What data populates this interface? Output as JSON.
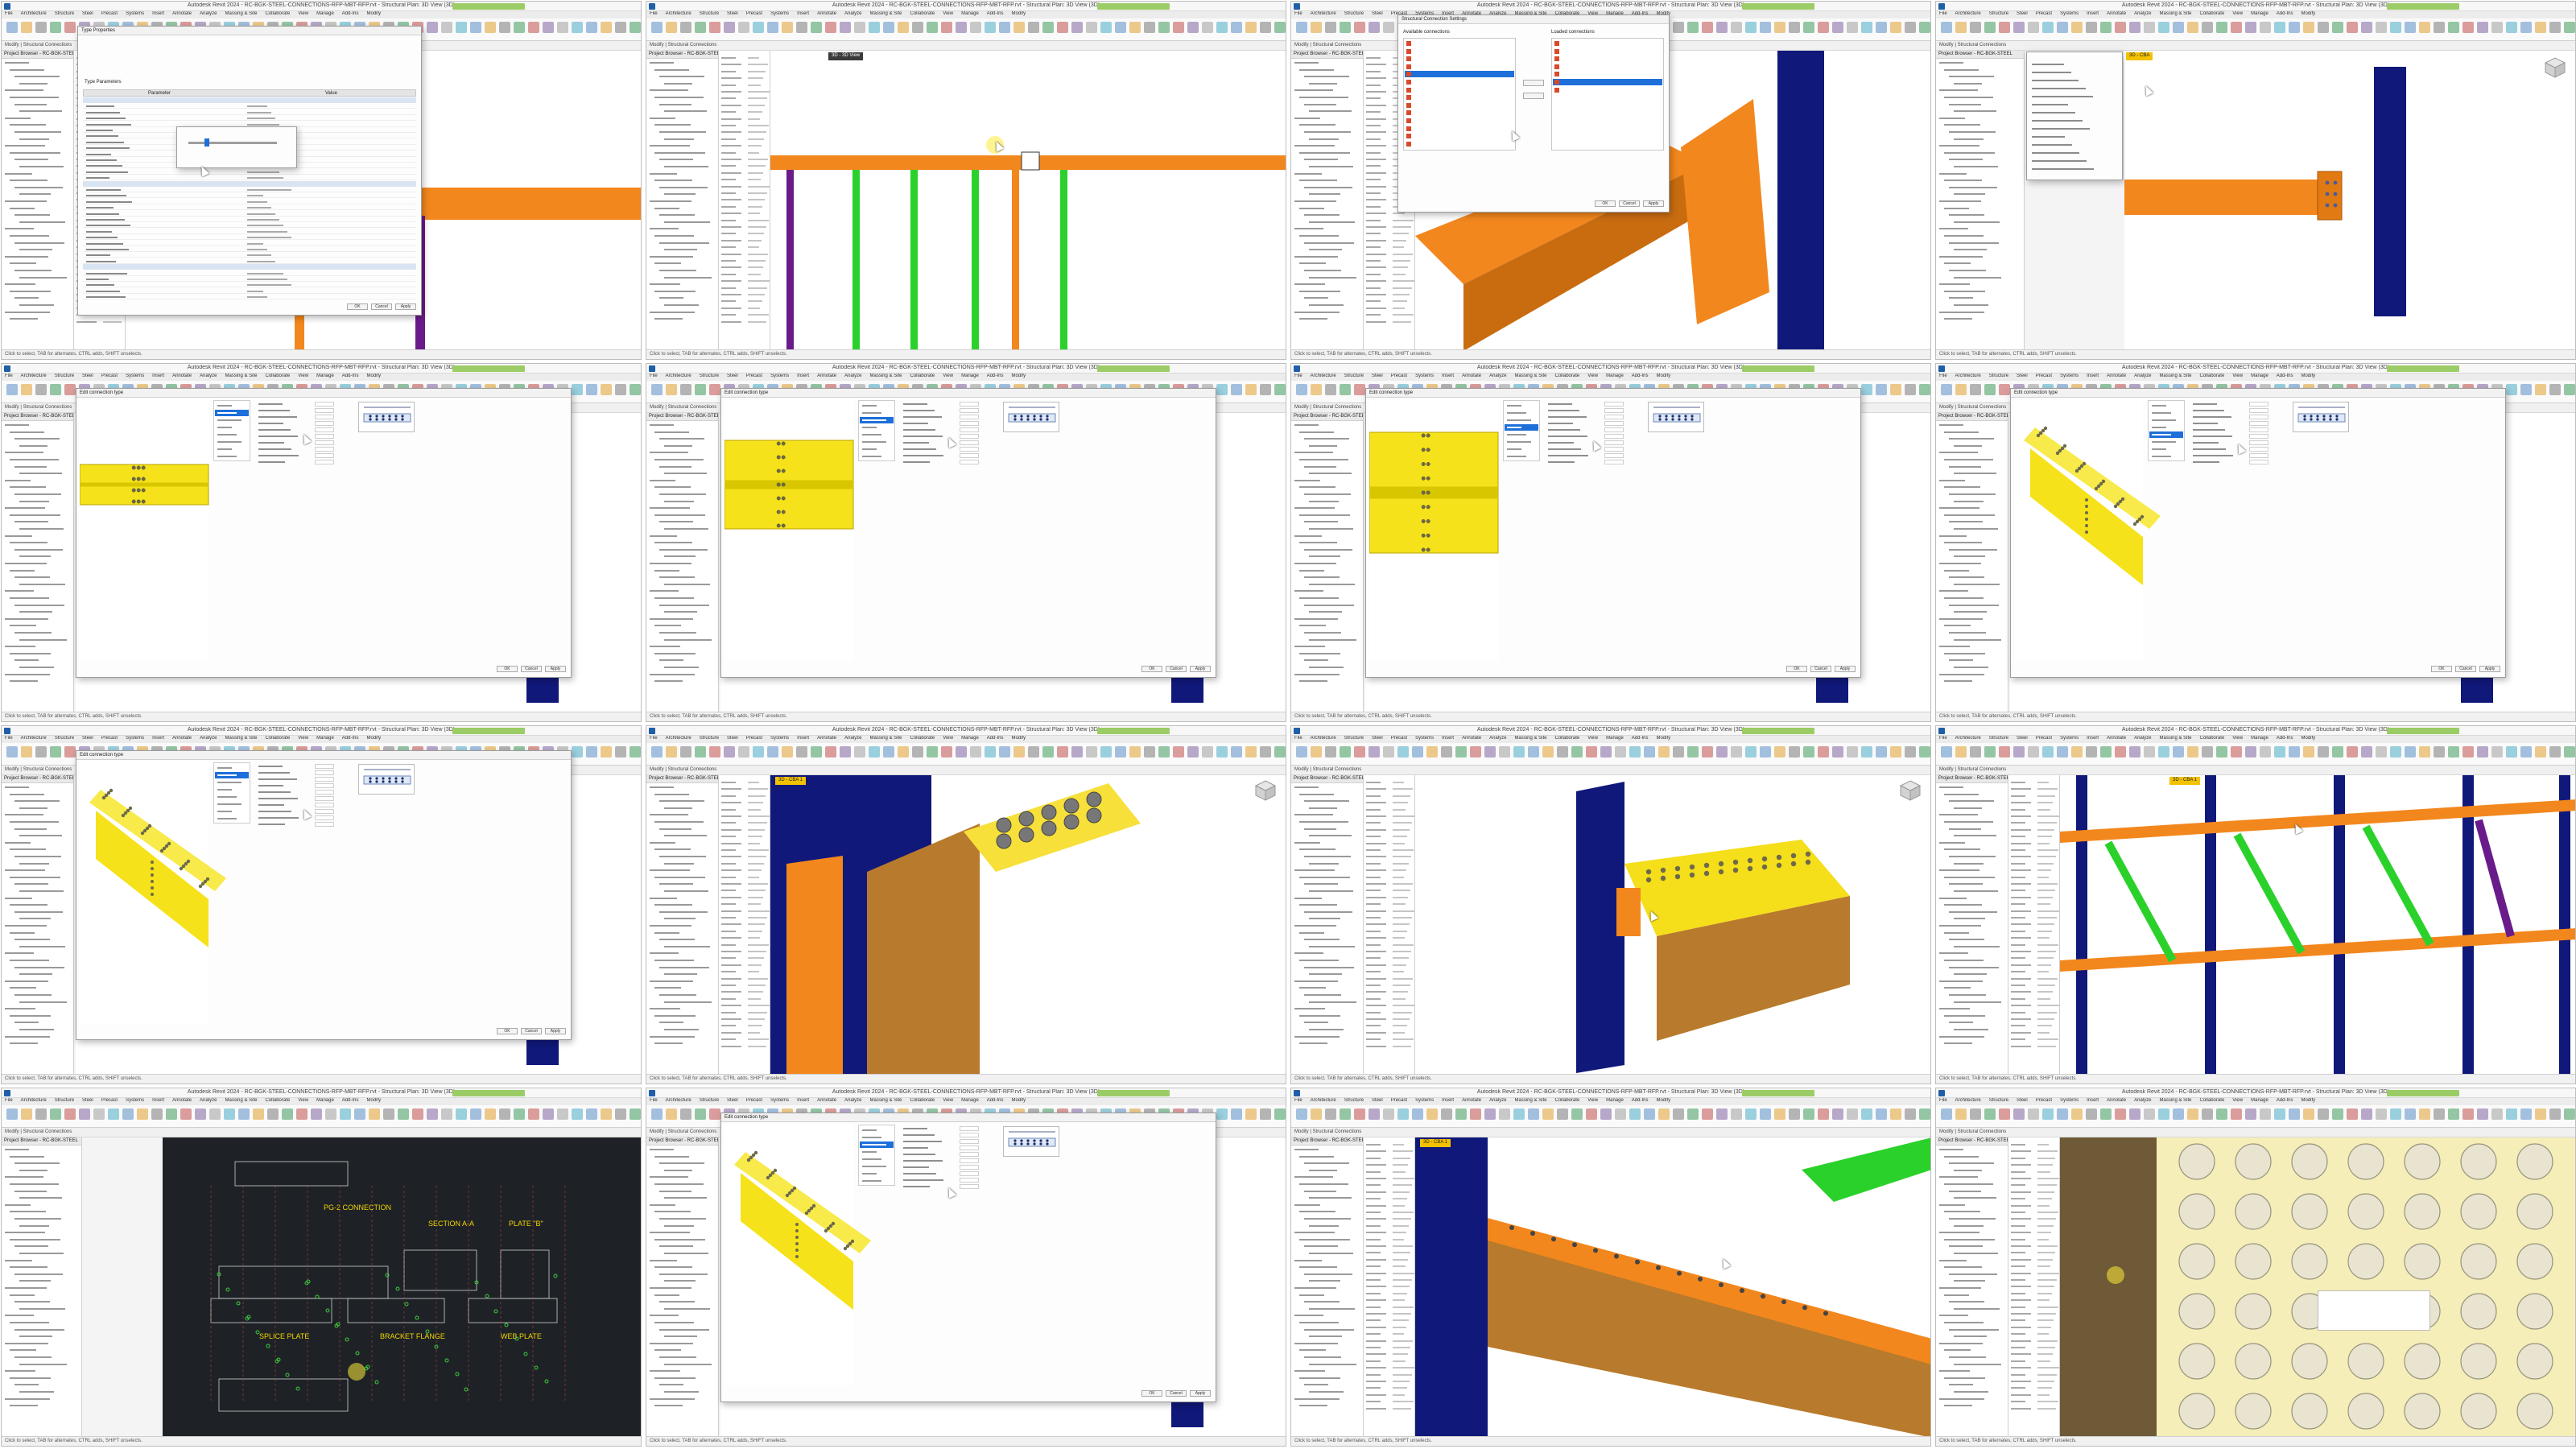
{
  "app": {
    "title": "Autodesk Revit 2024 - RC-BGK-STEEL-CONNECTIONS-RFP-MBT-RFP.rvt - Structural Plan: 3D View (3D)",
    "ribbon_tabs": [
      "File",
      "Architecture",
      "Structure",
      "Steel",
      "Precast",
      "Systems",
      "Insert",
      "Annotate",
      "Analyze",
      "Massing & Site",
      "Collaborate",
      "View",
      "Manage",
      "Add-Ins",
      "Modify"
    ],
    "project_browser_title": "Project Browser - RC-BGK-STEEL",
    "properties_title": "Properties",
    "status_text": "Click to select, TAB for alternates, CTRL adds, SHIFT unselects.",
    "options_bar": "Modify | Structural Connections"
  },
  "tiles": [
    {
      "id": 1,
      "view_tab": "",
      "dialog": "Type Properties",
      "desc_labels": [
        "Type Parameters",
        "Parameter",
        "Value"
      ]
    },
    {
      "id": 2,
      "view_tab": "3D - 3D View",
      "dialog": ""
    },
    {
      "id": 3,
      "view_tab": "",
      "dialog": "Structural Connection Settings",
      "desc_labels": [
        "Available connections",
        "Loaded connections",
        "OK",
        "Cancel"
      ]
    },
    {
      "id": 4,
      "view_tab": "3D - CBA",
      "dialog": ""
    },
    {
      "id": 5,
      "view_tab": "",
      "dialog": "Edit connection type"
    },
    {
      "id": 6,
      "view_tab": "",
      "dialog": "Edit connection type"
    },
    {
      "id": 7,
      "view_tab": "",
      "dialog": "Edit connection type"
    },
    {
      "id": 8,
      "view_tab": "",
      "dialog": "Edit connection type"
    },
    {
      "id": 9,
      "view_tab": "",
      "dialog": "Edit connection type"
    },
    {
      "id": 10,
      "view_tab": "3D - CBA 1",
      "dialog": ""
    },
    {
      "id": 11,
      "view_tab": "",
      "dialog": ""
    },
    {
      "id": 12,
      "view_tab": "3D - CBA 1",
      "dialog": ""
    },
    {
      "id": 13,
      "view_tab": "",
      "dialog": "",
      "cad_labels": [
        "PG-2 CONNECTION",
        "SECTION A-A",
        "PLATE \"B\"",
        "SPLICE PLATE",
        "BRACKET FLANGE",
        "WEB PLATE"
      ]
    },
    {
      "id": 14,
      "view_tab": "",
      "dialog": "Edit connection type"
    },
    {
      "id": 15,
      "view_tab": "3D - CBA 1",
      "dialog": ""
    },
    {
      "id": 16,
      "view_tab": "",
      "dialog": ""
    }
  ],
  "buttons": {
    "ok": "OK",
    "cancel": "Cancel",
    "apply": "Apply"
  },
  "colors": {
    "orange": "#f2871d",
    "yellow": "#f5e21a",
    "navy": "#10187a",
    "green": "#2bd12b",
    "purple": "#6a1b8a",
    "bolt": "#6d6a4a"
  }
}
